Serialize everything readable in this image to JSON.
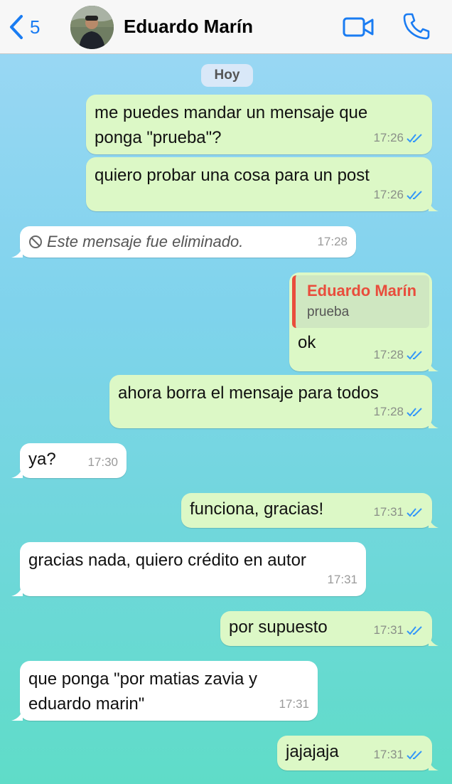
{
  "header": {
    "back_count": "5",
    "contact_name": "Eduardo Marín"
  },
  "date_pill": "Hoy",
  "messages": [
    {
      "text": "me puedes mandar un mensaje que\nponga \"prueba\"?",
      "time": "17:26"
    },
    {
      "text": "quiero probar una cosa para un post",
      "time": "17:26"
    },
    {
      "text": "Este mensaje fue eliminado.",
      "time": "17:28"
    },
    {
      "quote_name": "Eduardo Marín",
      "quote_text": "prueba",
      "text": "ok",
      "time": "17:28"
    },
    {
      "text": "ahora borra el mensaje para todos",
      "time": "17:28"
    },
    {
      "text": "ya?",
      "time": "17:30"
    },
    {
      "text": "funciona, gracias!",
      "time": "17:31"
    },
    {
      "text": "gracias nada, quiero crédito en autor",
      "time": "17:31"
    },
    {
      "text": "por supuesto",
      "time": "17:31"
    },
    {
      "text": "que ponga \"por matias zavia y\neduardo marin\"",
      "time": "17:31"
    },
    {
      "text": "jajajaja",
      "time": "17:31"
    }
  ],
  "colors": {
    "accent": "#1a7cf2",
    "outgoing_bubble": "#dcf8c6",
    "incoming_bubble": "#ffffff",
    "read_ticks": "#3497f9",
    "quote_author": "#e94d3c"
  }
}
